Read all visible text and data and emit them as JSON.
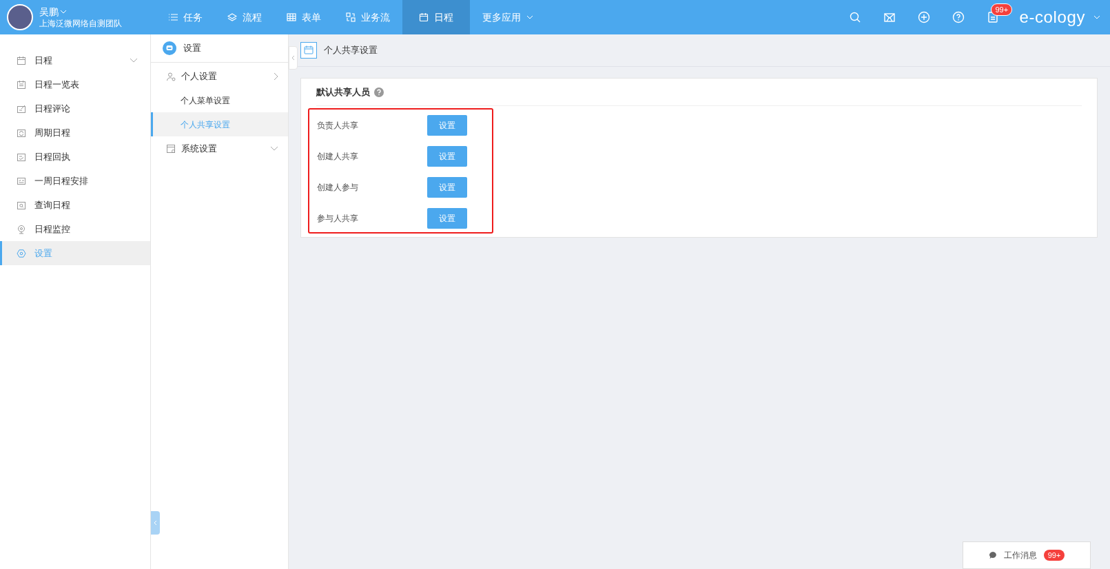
{
  "user": {
    "name": "吴鹏",
    "team": "上海泛微网络自测团队"
  },
  "nav": [
    {
      "label": "任务",
      "kind": "list",
      "selected": false
    },
    {
      "label": "流程",
      "kind": "layers",
      "selected": false
    },
    {
      "label": "表单",
      "kind": "table",
      "selected": false
    },
    {
      "label": "业务流",
      "kind": "flow",
      "selected": false
    },
    {
      "label": "日程",
      "kind": "calendar",
      "selected": true
    },
    {
      "label": "更多应用",
      "kind": "dropdown",
      "selected": false
    }
  ],
  "header_tools": [
    {
      "kind": "search"
    },
    {
      "kind": "mail"
    },
    {
      "kind": "plus"
    },
    {
      "kind": "help"
    },
    {
      "kind": "doc",
      "badge": "99+"
    }
  ],
  "brand": "e-cology",
  "sidebar": {
    "items": [
      {
        "label": "日程",
        "kind": "calendar",
        "selected": false,
        "expandable": true
      },
      {
        "label": "日程一览表",
        "kind": "list",
        "selected": false,
        "expandable": false
      },
      {
        "label": "日程评论",
        "kind": "edit",
        "selected": false,
        "expandable": false
      },
      {
        "label": "周期日程",
        "kind": "cycle",
        "selected": false,
        "expandable": false
      },
      {
        "label": "日程回执",
        "kind": "receipt",
        "selected": false,
        "expandable": false
      },
      {
        "label": "一周日程安排",
        "kind": "week",
        "selected": false,
        "expandable": false
      },
      {
        "label": "查询日程",
        "kind": "query",
        "selected": false,
        "expandable": false
      },
      {
        "label": "日程监控",
        "kind": "camera",
        "selected": false,
        "expandable": false
      },
      {
        "label": "设置",
        "kind": "settings",
        "selected": true,
        "expandable": false
      }
    ]
  },
  "submenu": {
    "title": "设置",
    "groups": [
      {
        "label": "个人设置",
        "kind": "person",
        "expanded": true,
        "children": [
          {
            "label": "个人菜单设置",
            "selected": false
          },
          {
            "label": "个人共享设置",
            "selected": true
          }
        ]
      },
      {
        "label": "系统设置",
        "kind": "system",
        "expanded": false
      }
    ]
  },
  "content": {
    "title": "个人共享设置",
    "section_title": "默认共享人员",
    "rows": [
      {
        "label": "负责人共享",
        "button": "设置"
      },
      {
        "label": "创建人共享",
        "button": "设置"
      },
      {
        "label": "创建人参与",
        "button": "设置"
      },
      {
        "label": "参与人共享",
        "button": "设置"
      }
    ]
  },
  "message_bar": {
    "label": "工作消息",
    "badge": "99+"
  }
}
